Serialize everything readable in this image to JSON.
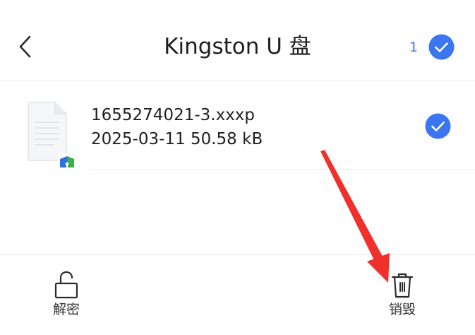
{
  "header": {
    "back_icon": "chevron-left-icon",
    "title": "Kingston U 盘",
    "selected_count": "1",
    "select_all_icon": "check-circle-icon"
  },
  "files": [
    {
      "name": "1655274021-3.xxxp",
      "meta": "2025-03-11  50.58 kB",
      "icon": "encrypted-document-icon",
      "selected": true
    }
  ],
  "toolbar": {
    "decrypt_label": "解密",
    "decrypt_icon": "unlock-icon",
    "destroy_label": "销毁",
    "destroy_icon": "trash-icon"
  },
  "colors": {
    "accent": "#3b76f0",
    "annotation_arrow": "#f0302a",
    "divider": "#ededed",
    "shield_blue": "#2f6fe0",
    "shield_green": "#36b24a"
  }
}
